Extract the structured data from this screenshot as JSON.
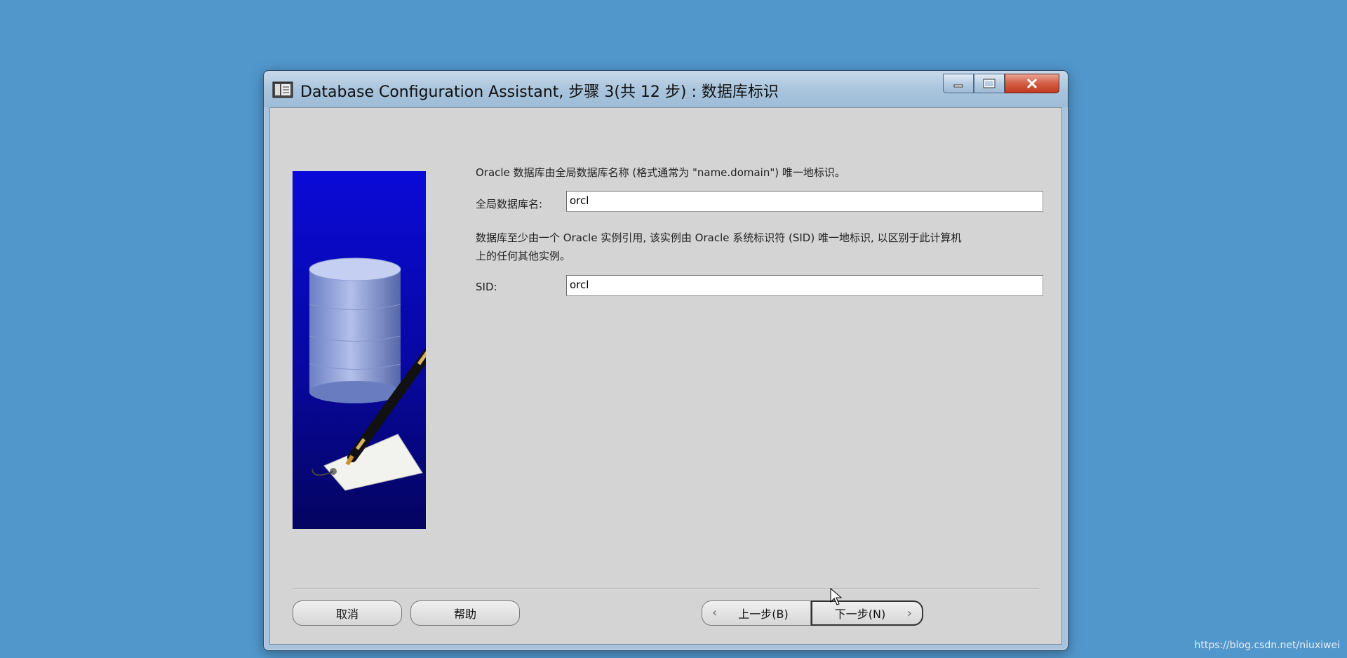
{
  "window": {
    "title": "Database Configuration Assistant, 步骤 3(共 12 步) : 数据库标识"
  },
  "content": {
    "intro_text": "Oracle 数据库由全局数据库名称 (格式通常为 \"name.domain\") 唯一地标识。",
    "global_db_label": "全局数据库名:",
    "global_db_value": "orcl",
    "sid_description_line1": "数据库至少由一个 Oracle 实例引用, 该实例由 Oracle 系统标识符 (SID) 唯一地标识, 以区别于此计算机",
    "sid_description_line2": "上的任何其他实例。",
    "sid_label": "SID:",
    "sid_value": "orcl"
  },
  "buttons": {
    "cancel": "取消",
    "help": "帮助",
    "back": "上一步(B)",
    "next": "下一步(N)"
  },
  "watermark": "https://blog.csdn.net/niuxiwei",
  "colors": {
    "desktop": "#5197cc",
    "client_bg": "#d4d4d4",
    "close_button": "#d45d45",
    "side_image": "#0808a0"
  }
}
